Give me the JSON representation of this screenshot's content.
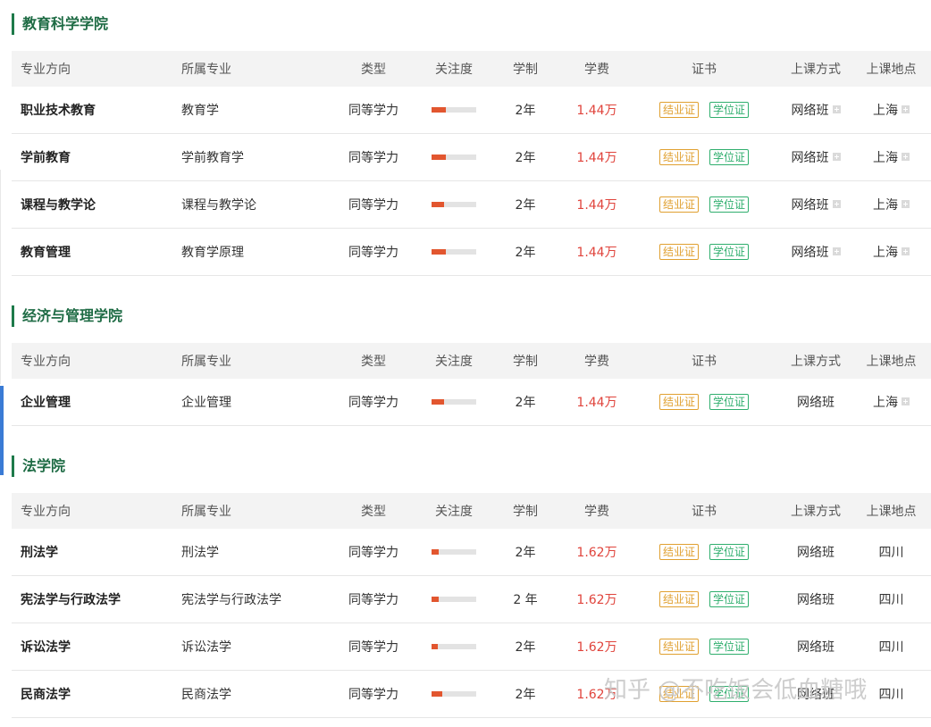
{
  "headers": {
    "direction": "专业方向",
    "major": "所属专业",
    "type": "类型",
    "attention": "关注度",
    "duration": "学制",
    "fee": "学费",
    "certificate": "证书",
    "mode": "上课方式",
    "location": "上课地点"
  },
  "sections": [
    {
      "title": "教育科学学院",
      "rows": [
        {
          "direction": "职业技术教育",
          "major": "教育学",
          "type": "同等学力",
          "attention": 0.32,
          "duration": "2年",
          "fee": "1.44万",
          "cert_grad": "结业证",
          "cert_degree": "学位证",
          "mode": "网络班",
          "location": "上海"
        },
        {
          "direction": "学前教育",
          "major": "学前教育学",
          "type": "同等学力",
          "attention": 0.32,
          "duration": "2年",
          "fee": "1.44万",
          "cert_grad": "结业证",
          "cert_degree": "学位证",
          "mode": "网络班",
          "location": "上海"
        },
        {
          "direction": "课程与教学论",
          "major": "课程与教学论",
          "type": "同等学力",
          "attention": 0.28,
          "duration": "2年",
          "fee": "1.44万",
          "cert_grad": "结业证",
          "cert_degree": "学位证",
          "mode": "网络班",
          "location": "上海"
        },
        {
          "direction": "教育管理",
          "major": "教育学原理",
          "type": "同等学力",
          "attention": 0.32,
          "duration": "2年",
          "fee": "1.44万",
          "cert_grad": "结业证",
          "cert_degree": "学位证",
          "mode": "网络班",
          "location": "上海"
        }
      ]
    },
    {
      "title": "经济与管理学院",
      "rows": [
        {
          "direction": "企业管理",
          "major": "企业管理",
          "type": "同等学力",
          "attention": 0.28,
          "duration": "2年",
          "fee": "1.44万",
          "cert_grad": "结业证",
          "cert_degree": "学位证",
          "mode": "网络班",
          "location": "上海"
        }
      ]
    },
    {
      "title": "法学院",
      "rows": [
        {
          "direction": "刑法学",
          "major": "刑法学",
          "type": "同等学力",
          "attention": 0.16,
          "duration": "2年",
          "fee": "1.62万",
          "cert_grad": "结业证",
          "cert_degree": "学位证",
          "mode": "网络班",
          "location": "四川"
        },
        {
          "direction": "宪法学与行政法学",
          "major": "宪法学与行政法学",
          "type": "同等学力",
          "attention": 0.16,
          "duration": "2 年",
          "fee": "1.62万",
          "cert_grad": "结业证",
          "cert_degree": "学位证",
          "mode": "网络班",
          "location": "四川"
        },
        {
          "direction": "诉讼法学",
          "major": "诉讼法学",
          "type": "同等学力",
          "attention": 0.14,
          "duration": "2年",
          "fee": "1.62万",
          "cert_grad": "结业证",
          "cert_degree": "学位证",
          "mode": "网络班",
          "location": "四川"
        },
        {
          "direction": "民商法学",
          "major": "民商法学",
          "type": "同等学力",
          "attention": 0.24,
          "duration": "2年",
          "fee": "1.62万",
          "cert_grad": "结业证",
          "cert_degree": "学位证",
          "mode": "网络班",
          "location": "四川"
        }
      ]
    }
  ],
  "watermark": "知乎 @不吃饭会低血糖哦",
  "colors": {
    "accent_green": "#1e6b44",
    "fee_red": "#e0443c",
    "bar_orange": "#e2562f",
    "badge_orange": "#e0a030",
    "badge_green": "#2fae6d"
  }
}
